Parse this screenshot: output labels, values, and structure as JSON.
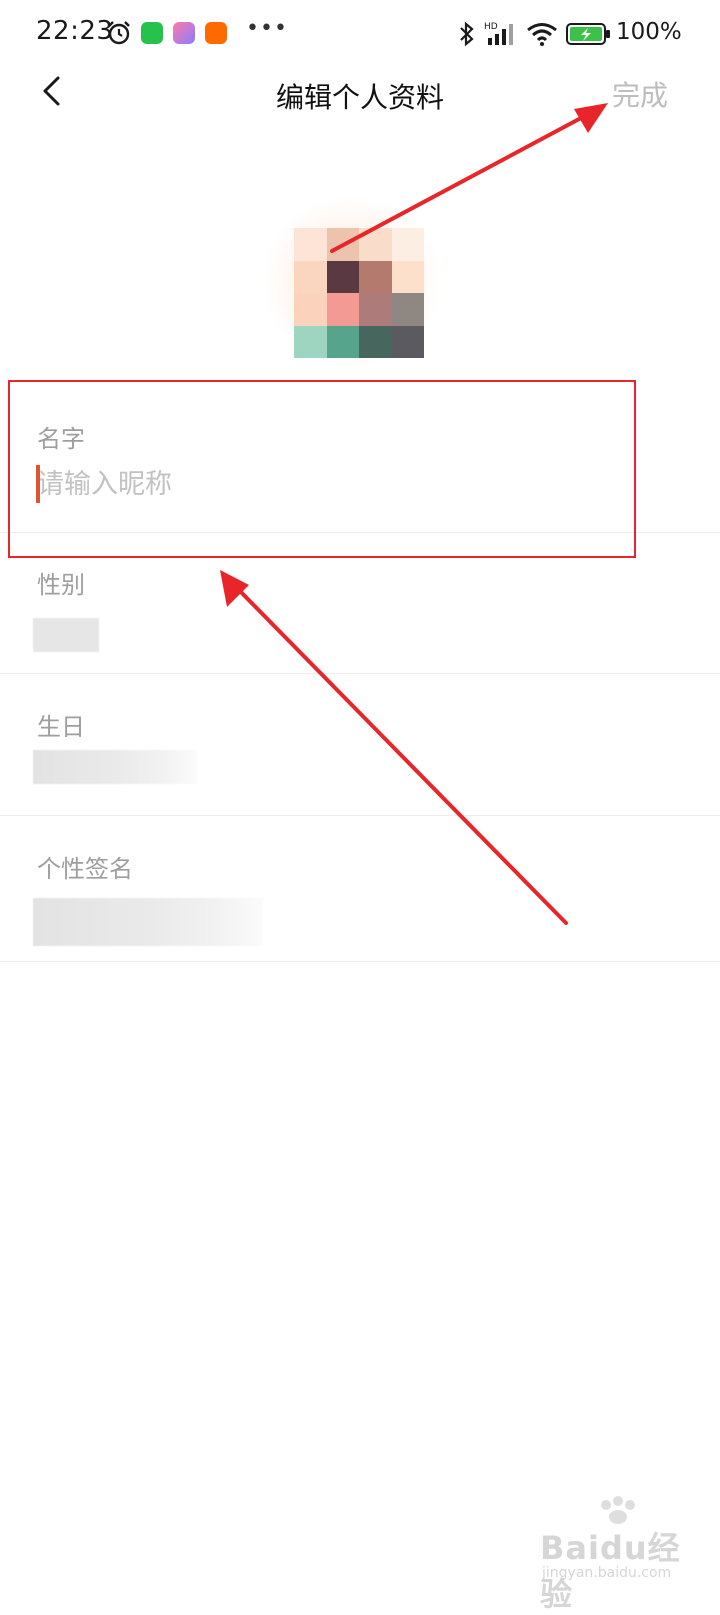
{
  "status_bar": {
    "time": "22:23",
    "battery": "100%"
  },
  "nav": {
    "title": "编辑个人资料",
    "done_label": "完成"
  },
  "fields": {
    "name_label": "名字",
    "name_placeholder": "请输入昵称",
    "gender_label": "性别",
    "birthday_label": "生日",
    "signature_label": "个性签名"
  },
  "watermark": {
    "main": "Baidu经验",
    "sub": "jingyan.baidu.com"
  },
  "colors": {
    "annotation": "#e8262a",
    "caret": "#e2542f"
  }
}
